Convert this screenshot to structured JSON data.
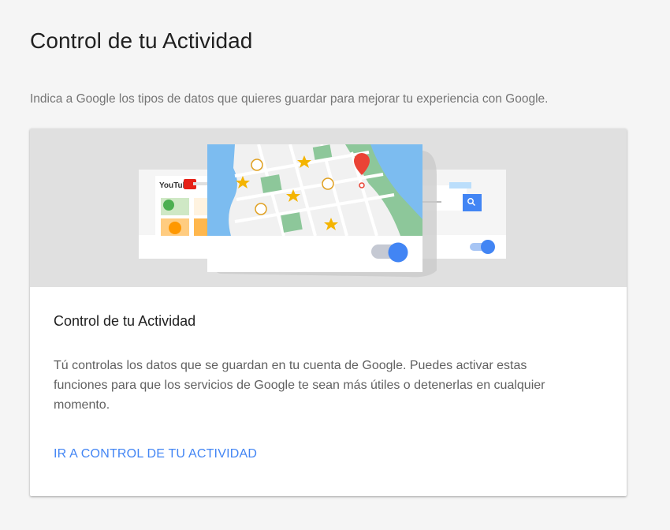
{
  "page": {
    "title": "Control de tu Actividad",
    "subtitle": "Indica a Google los tipos de datos que quieres guardar para mejorar tu experiencia con Google."
  },
  "card": {
    "title": "Control de tu Actividad",
    "body": "Tú controlas los datos que se guardan en tu cuenta de Google. Puedes activar estas funciones para que los servicios de Google te sean más útiles o detenerlas en cualquier momento.",
    "link_label": "IR A CONTROL DE TU ACTIVIDAD"
  },
  "illustration": {
    "youtube_logo": "YouTube",
    "toggles": {
      "left": true,
      "right": true
    },
    "icons": [
      "map-pin-icon",
      "star-icon",
      "search-icon",
      "home-icon"
    ]
  },
  "colors": {
    "accent": "#4285f4",
    "map_water": "#7cbcf0",
    "map_park": "#8dc79a",
    "pin": "#ea4335",
    "star": "#f4b400",
    "hero_bg": "#e0e0e0"
  }
}
